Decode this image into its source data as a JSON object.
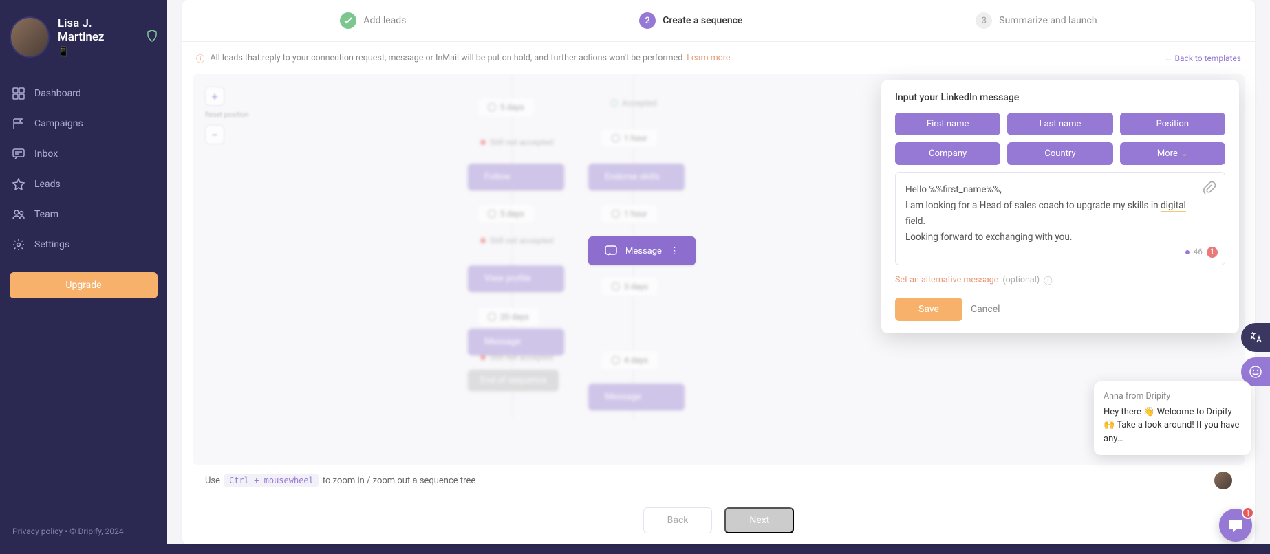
{
  "profile": {
    "name": "Lisa J. Martinez",
    "emoji": "📱"
  },
  "nav": {
    "dashboard": "Dashboard",
    "campaigns": "Campaigns",
    "inbox": "Inbox",
    "leads": "Leads",
    "team": "Team",
    "settings": "Settings"
  },
  "upgrade": "Upgrade",
  "footer": {
    "privacy": "Privacy policy",
    "sep": "  •  ",
    "copyright": "© Dripify, 2024"
  },
  "stepper": {
    "step1": {
      "label": "Add leads"
    },
    "step2": {
      "num": "2",
      "label": "Create a sequence"
    },
    "step3": {
      "num": "3",
      "label": "Summarize and launch"
    }
  },
  "infobar": {
    "text": "All leads that reply to your connection request, message or InMail will be put on hold, and further actions won't be performed",
    "learn": "Learn more",
    "back": "← Back to templates"
  },
  "zoom": {
    "reset": "Reset position"
  },
  "sequence": {
    "d5a": "5 days",
    "d5b": "5 days",
    "h1a": "1 hour",
    "h1b": "1 hour",
    "d3": "3 days",
    "d20": "20 days",
    "d4": "4 days",
    "accepted": "Accepted",
    "sna1": "Still not accepted",
    "sna2": "Still not accepted",
    "sna3": "Still not accepted",
    "follow": "Follow",
    "endorse": "Endorse skills",
    "message": "Message",
    "message2": "Message",
    "message3": "Message",
    "view": "View profile",
    "end": "End of sequence"
  },
  "modal": {
    "title": "Input your LinkedIn message",
    "vars": {
      "first": "First name",
      "last": "Last name",
      "position": "Position",
      "company": "Company",
      "country": "Country",
      "more": "More"
    },
    "msg_line1": "Hello %%first_name%%,",
    "msg_line2_a": "I am looking for a Head of sales coach to upgrade my skills in ",
    "msg_line2_u": "digital",
    "msg_line2_b": " field.",
    "msg_line3": "Looking forward to exchanging with you.",
    "count": "46",
    "badge": "1",
    "alt_link": "Set an alternative message",
    "alt_opt": "(optional)",
    "save": "Save",
    "cancel": "Cancel"
  },
  "hint": {
    "pre": "Use",
    "key": "Ctrl + mousewheel",
    "post": " to zoom in / zoom out a sequence tree"
  },
  "actions": {
    "back": "Back",
    "next": "Next"
  },
  "chat": {
    "from": "Anna from Dripify",
    "msg": "Hey there 👋 Welcome to Dripify 🙌 Take a look around! If you have any…",
    "badge": "1"
  }
}
